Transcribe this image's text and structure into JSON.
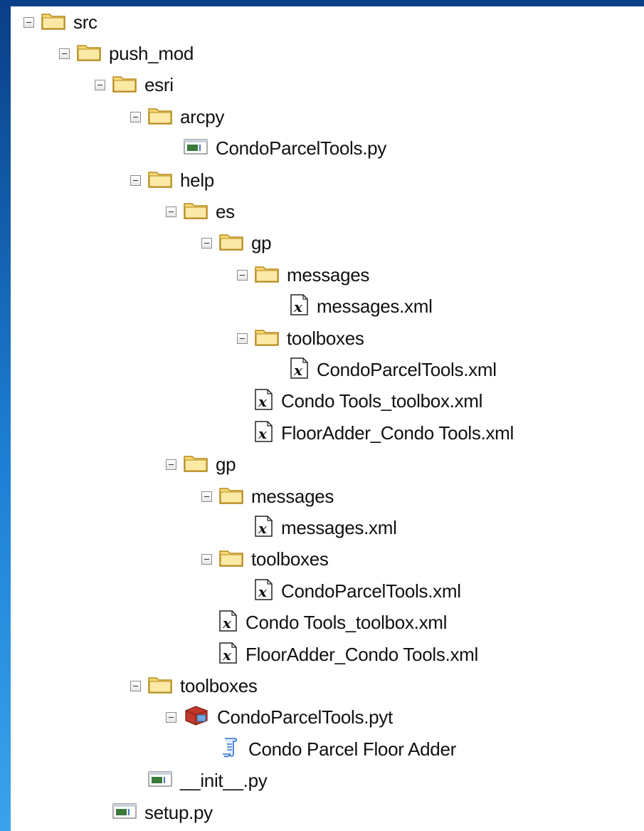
{
  "tree": [
    {
      "label": "src",
      "type": "folder",
      "depth": 0,
      "toggle": true
    },
    {
      "label": "push_mod",
      "type": "folder",
      "depth": 1,
      "toggle": true
    },
    {
      "label": "esri",
      "type": "folder",
      "depth": 2,
      "toggle": true
    },
    {
      "label": "arcpy",
      "type": "folder",
      "depth": 3,
      "toggle": true
    },
    {
      "label": "CondoParcelTools.py",
      "type": "py",
      "depth": 4,
      "toggle": false
    },
    {
      "label": "help",
      "type": "folder",
      "depth": 3,
      "toggle": true
    },
    {
      "label": "es",
      "type": "folder",
      "depth": 4,
      "toggle": true
    },
    {
      "label": "gp",
      "type": "folder",
      "depth": 5,
      "toggle": true
    },
    {
      "label": "messages",
      "type": "folder",
      "depth": 6,
      "toggle": true
    },
    {
      "label": "messages.xml",
      "type": "xml",
      "depth": 7,
      "toggle": false
    },
    {
      "label": "toolboxes",
      "type": "folder",
      "depth": 6,
      "toggle": true
    },
    {
      "label": "CondoParcelTools.xml",
      "type": "xml",
      "depth": 7,
      "toggle": false
    },
    {
      "label": "Condo Tools_toolbox.xml",
      "type": "xml",
      "depth": 6,
      "toggle": false
    },
    {
      "label": "FloorAdder_Condo Tools.xml",
      "type": "xml",
      "depth": 6,
      "toggle": false
    },
    {
      "label": "gp",
      "type": "folder",
      "depth": 4,
      "toggle": true
    },
    {
      "label": "messages",
      "type": "folder",
      "depth": 5,
      "toggle": true
    },
    {
      "label": "messages.xml",
      "type": "xml",
      "depth": 6,
      "toggle": false
    },
    {
      "label": "toolboxes",
      "type": "folder",
      "depth": 5,
      "toggle": true
    },
    {
      "label": "CondoParcelTools.xml",
      "type": "xml",
      "depth": 6,
      "toggle": false
    },
    {
      "label": "Condo Tools_toolbox.xml",
      "type": "xml",
      "depth": 5,
      "toggle": false
    },
    {
      "label": "FloorAdder_Condo Tools.xml",
      "type": "xml",
      "depth": 5,
      "toggle": false
    },
    {
      "label": "toolboxes",
      "type": "folder",
      "depth": 3,
      "toggle": true
    },
    {
      "label": "CondoParcelTools.pyt",
      "type": "pyt",
      "depth": 4,
      "toggle": true
    },
    {
      "label": "Condo Parcel Floor Adder",
      "type": "script",
      "depth": 5,
      "toggle": false
    },
    {
      "label": "__init__.py",
      "type": "py",
      "depth": 3,
      "toggle": false
    },
    {
      "label": "setup.py",
      "type": "py",
      "depth": 2,
      "toggle": false
    }
  ],
  "icons": {
    "folder": "folder-icon",
    "py": "python-file-icon",
    "xml": "xml-file-icon",
    "pyt": "python-toolbox-icon",
    "script": "script-tool-icon"
  },
  "colors": {
    "background": "#1d7fd4",
    "folder_fill": "#f7d774",
    "folder_stroke": "#b58a1c",
    "toolbox_red": "#c0392b",
    "script_blue": "#2e6fd1"
  }
}
